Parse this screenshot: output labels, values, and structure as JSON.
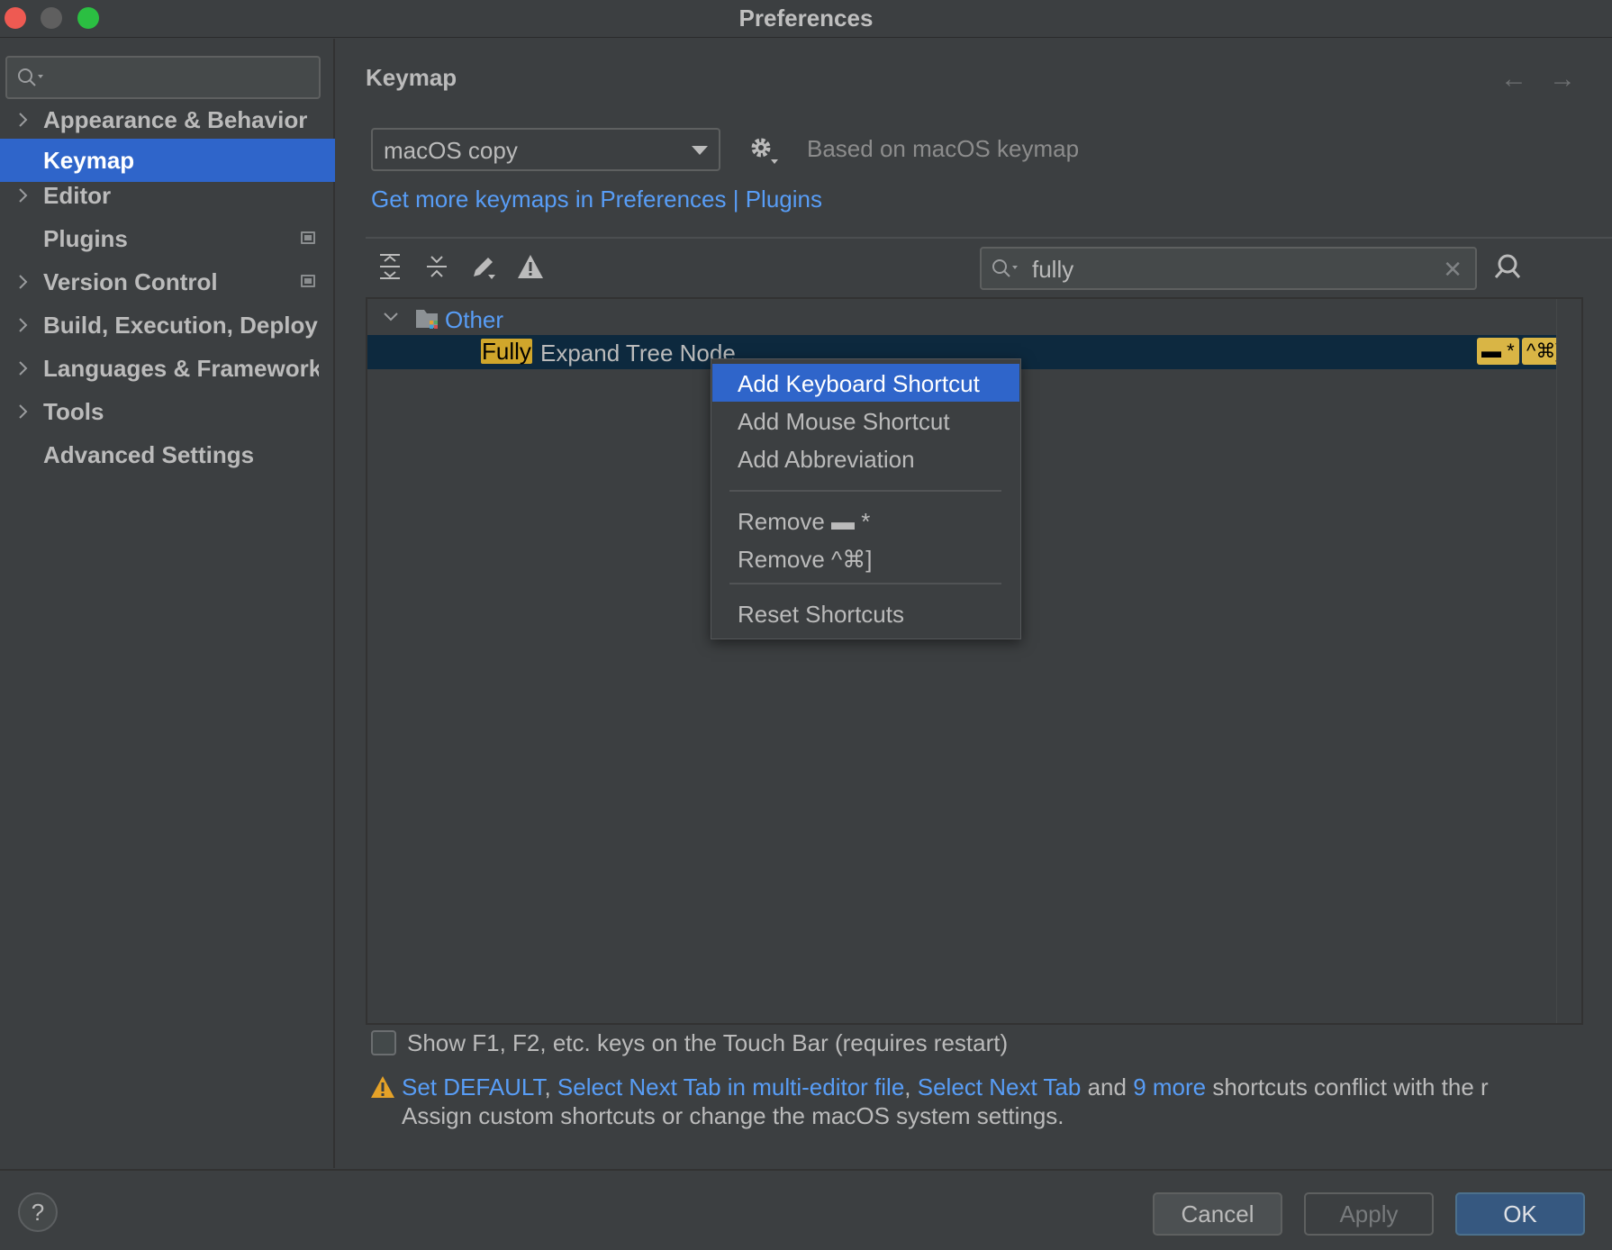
{
  "window": {
    "title": "Preferences"
  },
  "sidebar": {
    "search_placeholder": "",
    "items": [
      {
        "label": "Appearance & Behavior",
        "expandable": true
      },
      {
        "label": "Keymap",
        "selected": true
      },
      {
        "label": "Editor",
        "expandable": true
      },
      {
        "label": "Plugins",
        "badge": true
      },
      {
        "label": "Version Control",
        "expandable": true,
        "badge": true
      },
      {
        "label": "Build, Execution, Deployment",
        "expandable": true
      },
      {
        "label": "Languages & Frameworks",
        "expandable": true
      },
      {
        "label": "Tools",
        "expandable": true
      },
      {
        "label": "Advanced Settings"
      }
    ]
  },
  "main": {
    "title": "Keymap",
    "keymap_select": "macOS copy",
    "based_on": "Based on macOS keymap",
    "get_more_link": "Get more keymaps in Preferences | Plugins",
    "filter": {
      "value": "fully"
    },
    "tree": {
      "group": "Other",
      "row": {
        "match": "Fully",
        "rest": " Expand Tree Node",
        "shortcuts": [
          "▬ *",
          "^⌘]"
        ]
      }
    },
    "context_menu": [
      "Add Keyboard Shortcut",
      "Add Mouse Shortcut",
      "Add Abbreviation",
      "Remove ▬ *",
      "Remove ^⌘]",
      "Reset Shortcuts"
    ],
    "touchbar_checkbox": "Show F1, F2, etc. keys on the Touch Bar (requires restart)",
    "conflict": {
      "link1": "Set DEFAULT",
      "sep1": ", ",
      "link2": "Select Next Tab in multi-editor file",
      "sep2": ", ",
      "link3": "Select Next Tab",
      "and": " and ",
      "link4": "9 more",
      "tail": " shortcuts conflict with the r",
      "line2": "Assign custom shortcuts or change the macOS system settings."
    }
  },
  "footer": {
    "help": "?",
    "cancel": "Cancel",
    "apply": "Apply",
    "ok": "OK"
  },
  "colors": {
    "accent": "#2f65ca",
    "link": "#589df6",
    "highlight": "#d0a62b",
    "warning": "#e5a228"
  }
}
